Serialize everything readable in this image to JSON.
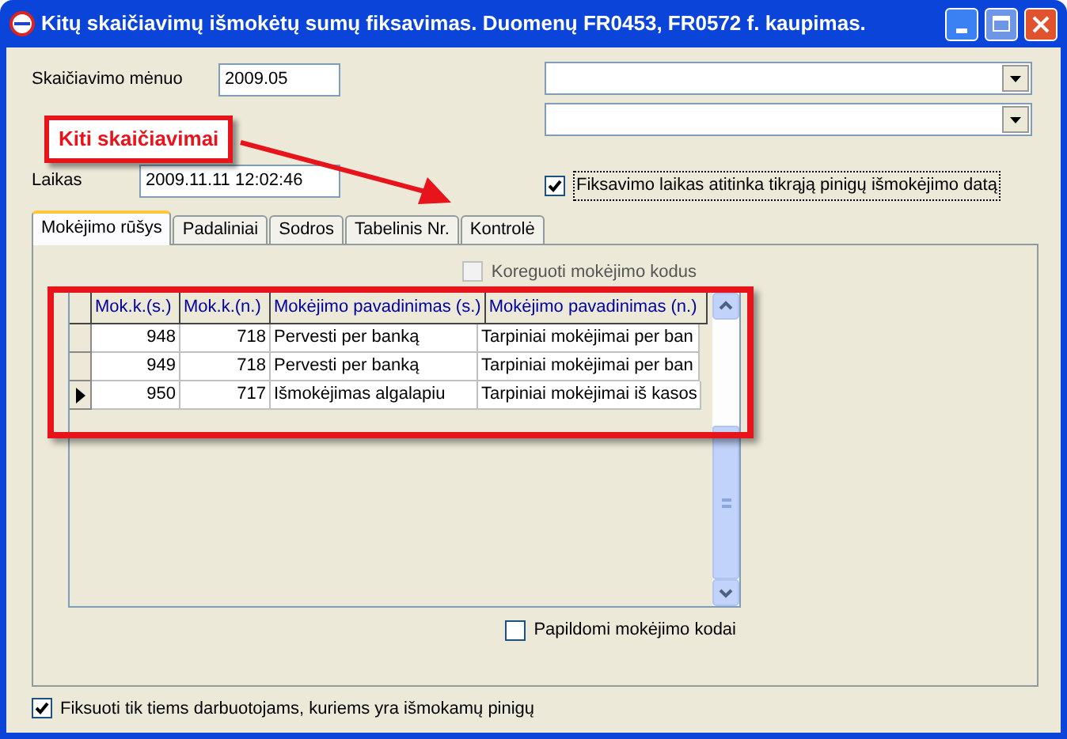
{
  "window": {
    "title": "Kitų skaičiavimų išmokėtų sumų fiksavimas. Duomenų FR0453, FR0572 f. kaupimas."
  },
  "fields": [
    {
      "label": "Skaičiavimo mėnuo",
      "value": "2009.05"
    },
    {
      "label": "Laikas",
      "value": "2009.11.11 12:02:46"
    }
  ],
  "fix_time_checkbox": {
    "label": "Fiksavimo laikas atitinka tikrąją pinigų išmokėjimo datą",
    "checked": true
  },
  "annotation": {
    "label": "Kiti skaičiavimai"
  },
  "tabs": [
    {
      "label": "Mokėjimo rūšys",
      "selected": true
    },
    {
      "label": "Padaliniai",
      "selected": false
    },
    {
      "label": "Sodros",
      "selected": false
    },
    {
      "label": "Tabelinis Nr.",
      "selected": false
    },
    {
      "label": "Kontrolė",
      "selected": false
    }
  ],
  "edit_codes_checkbox": {
    "label": "Koreguoti mokėjimo kodus",
    "checked": false,
    "disabled": true
  },
  "table": {
    "columns": [
      "Mok.k.(s.)",
      "Mok.k.(n.)",
      "Mokėjimo pavadinimas (s.)",
      "Mokėjimo pavadinimas (n.)"
    ],
    "rows": [
      {
        "cells": [
          "948",
          "718",
          "Pervesti per banką",
          "Tarpiniai mokėjimai per ban"
        ],
        "current": false
      },
      {
        "cells": [
          "949",
          "718",
          "Pervesti per banką",
          "Tarpiniai mokėjimai per ban"
        ],
        "current": false
      },
      {
        "cells": [
          "950",
          "717",
          "Išmokėjimas algalapiu",
          "Tarpiniai mokėjimai iš kasos"
        ],
        "current": true
      }
    ]
  },
  "extra_codes_checkbox": {
    "label": "Papildomi mokėjimo kodai",
    "checked": false
  },
  "only_paid_checkbox": {
    "label": "Fiksuoti tik tiems darbuotojams, kuriems yra išmokamų pinigų",
    "checked": true
  }
}
